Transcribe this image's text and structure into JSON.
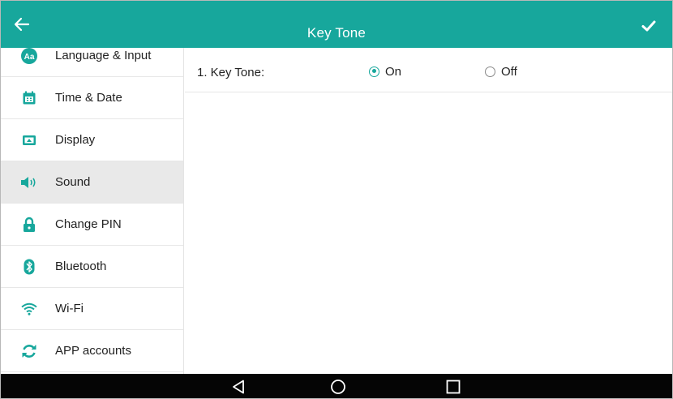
{
  "header": {
    "title": "Key Tone",
    "back_icon": "back-arrow-icon",
    "confirm_icon": "checkmark-icon",
    "bar_color": "#17a79c"
  },
  "sidebar": {
    "items": [
      {
        "label": "Language & Input",
        "icon": "language-icon"
      },
      {
        "label": "Time & Date",
        "icon": "calendar-icon"
      },
      {
        "label": "Display",
        "icon": "display-icon"
      },
      {
        "label": "Sound",
        "icon": "speaker-icon",
        "selected": true
      },
      {
        "label": "Change PIN",
        "icon": "lock-icon"
      },
      {
        "label": "Bluetooth",
        "icon": "bluetooth-icon"
      },
      {
        "label": "Wi-Fi",
        "icon": "wifi-icon"
      },
      {
        "label": "APP accounts",
        "icon": "sync-icon"
      }
    ]
  },
  "settings": {
    "key_tone": {
      "label": "1. Key Tone:",
      "options": [
        "On",
        "Off"
      ],
      "selected": "On"
    }
  },
  "navbar": {
    "buttons": [
      "back-triangle-icon",
      "home-circle-icon",
      "recent-square-icon"
    ]
  }
}
